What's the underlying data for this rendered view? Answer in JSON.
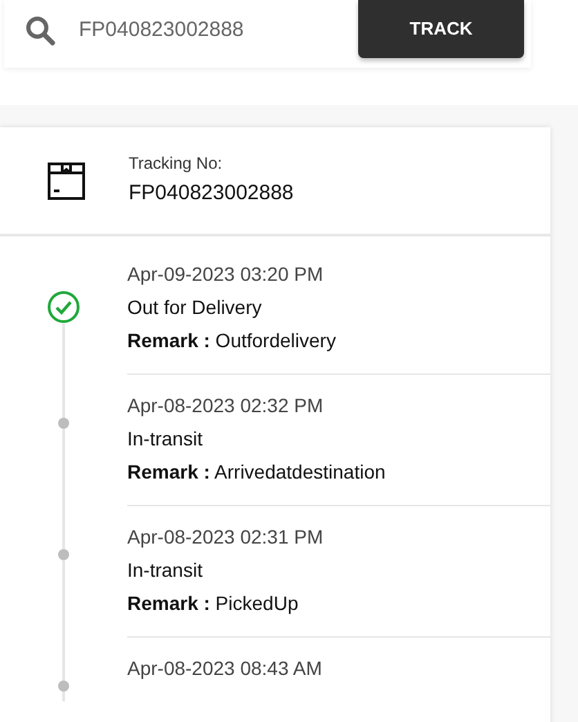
{
  "search": {
    "value": "FP040823002888",
    "button": "TRACK"
  },
  "tracking": {
    "label": "Tracking No:",
    "number": "FP040823002888"
  },
  "events": [
    {
      "completed": true,
      "datetime": "Apr-09-2023 03:20 PM",
      "status": "Out for Delivery",
      "remark": "**Remark :** Outfordelivery"
    },
    {
      "completed": false,
      "datetime": "Apr-08-2023 02:32 PM",
      "status": "In-transit",
      "remark": "**Remark :** Arrivedatdestination"
    },
    {
      "completed": false,
      "datetime": "Apr-08-2023 02:31 PM",
      "status": "In-transit",
      "remark": "**Remark :** PickedUp"
    },
    {
      "completed": false,
      "datetime": "Apr-08-2023 08:43 AM"
    }
  ]
}
